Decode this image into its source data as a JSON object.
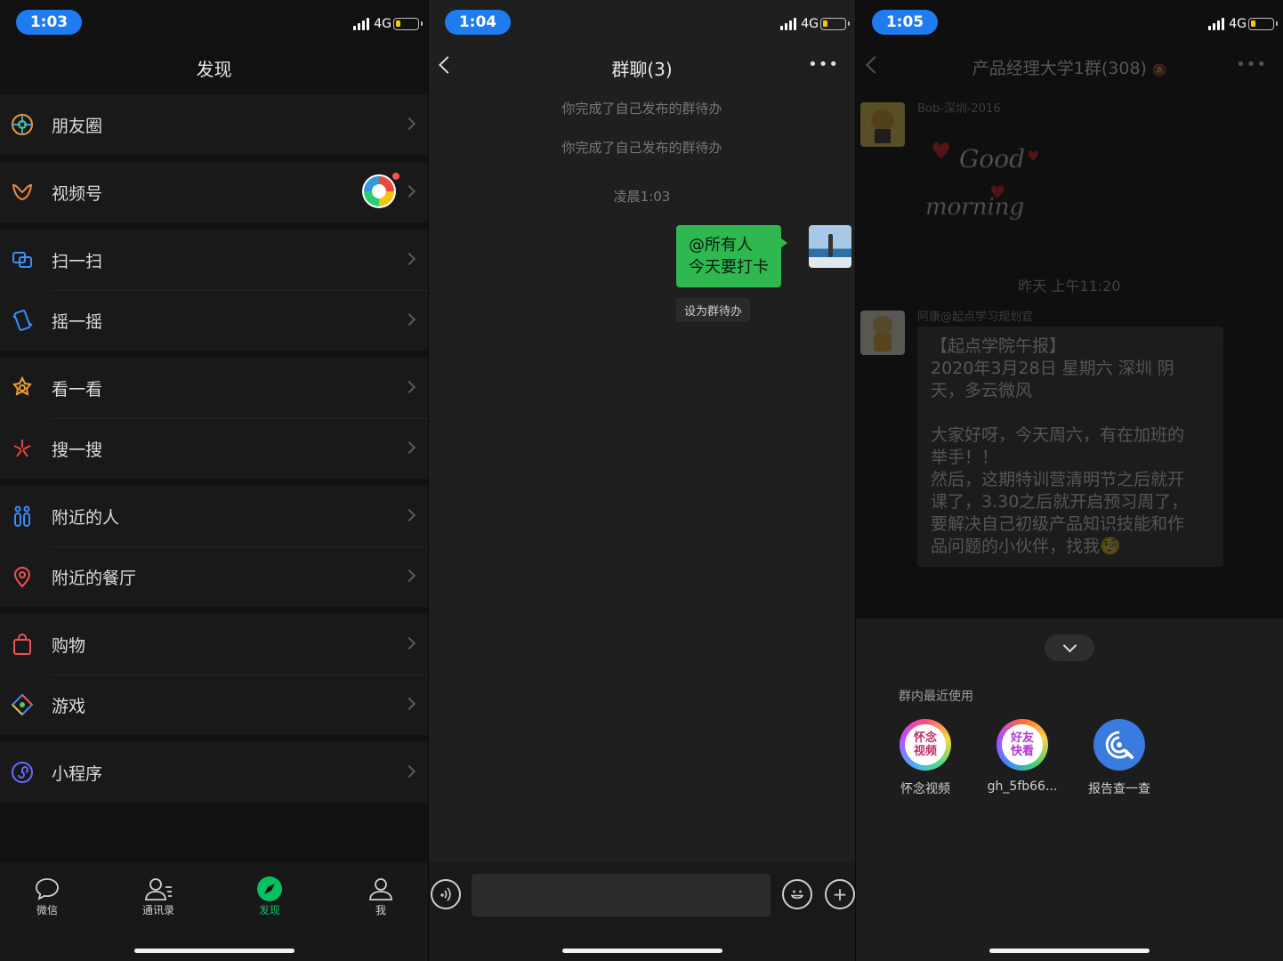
{
  "screen1": {
    "time": "1:03",
    "network": "4G",
    "title": "发现",
    "groups": [
      [
        {
          "label": "朋友圈",
          "icon": "moments-icon"
        }
      ],
      [
        {
          "label": "视频号",
          "icon": "channels-icon"
        }
      ],
      [
        {
          "label": "扫一扫",
          "icon": "scan-icon"
        },
        {
          "label": "摇一摇",
          "icon": "shake-icon"
        }
      ],
      [
        {
          "label": "看一看",
          "icon": "top-stories-icon"
        },
        {
          "label": "搜一搜",
          "icon": "search-icon"
        }
      ],
      [
        {
          "label": "附近的人",
          "icon": "people-nearby-icon"
        },
        {
          "label": "附近的餐厅",
          "icon": "restaurant-pin-icon"
        }
      ],
      [
        {
          "label": "购物",
          "icon": "shopping-bag-icon"
        },
        {
          "label": "游戏",
          "icon": "games-icon"
        }
      ],
      [
        {
          "label": "小程序",
          "icon": "mini-program-icon"
        }
      ]
    ],
    "tabs": [
      {
        "label": "微信",
        "icon": "chat-icon"
      },
      {
        "label": "通讯录",
        "icon": "contacts-icon"
      },
      {
        "label": "发现",
        "icon": "discover-compass-icon"
      },
      {
        "label": "我",
        "icon": "me-icon"
      }
    ],
    "active_tab": "发现",
    "accent": "#07c160"
  },
  "screen2": {
    "time": "1:04",
    "network": "4G",
    "title": "群聊(3)",
    "system_messages": [
      "你完成了自己发布的群待办",
      "你完成了自己发布的群待办"
    ],
    "timestamp": "凌晨1:03",
    "message_lines": [
      "@所有人",
      "今天要打卡"
    ],
    "message_chip": "设为群待办",
    "bubble_color": "#2eb84f"
  },
  "screen3": {
    "time": "1:05",
    "network": "4G",
    "title": "产品经理大学1群(308)",
    "sender1": "Bob-深圳-2016",
    "sticker_lines": [
      "Good",
      "morning"
    ],
    "timestamp": "昨天 上午11:20",
    "sender2": "阿康@起点学习规划官",
    "message_lines": [
      "【起点学院午报】",
      "2020年3月28日 星期六 深圳 阴",
      "天，多云微风",
      "",
      "大家好呀，今天周六，有在加班的",
      "举手！！",
      "然后，这期特训营清明节之后就开",
      "课了，3.30之后就开启预习周了，",
      "要解决自己初级产品知识技能和作",
      "品问题的小伙伴，找我🧐"
    ],
    "panel_label": "群内最近使用",
    "apps": [
      {
        "name": "怀念视频",
        "icon_text": "怀念视频"
      },
      {
        "name": "gh_5fb66...",
        "icon_text": "好友快看"
      },
      {
        "name": "报告查一查",
        "icon_text": ""
      }
    ]
  }
}
